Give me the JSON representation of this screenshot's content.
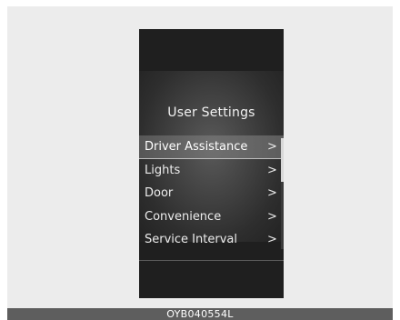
{
  "screen": {
    "title": "User Settings",
    "menu_items": [
      {
        "label": "Driver Assistance",
        "arrow": ">",
        "selected": true
      },
      {
        "label": "Lights",
        "arrow": ">",
        "selected": false
      },
      {
        "label": "Door",
        "arrow": ">",
        "selected": false
      },
      {
        "label": "Convenience",
        "arrow": ">",
        "selected": false
      },
      {
        "label": "Service Interval",
        "arrow": ">",
        "selected": false
      }
    ]
  },
  "figure_code": "OYB040554L",
  "colors": {
    "display_background": "#1f1f1f",
    "selection_highlight": "#8a8a8a",
    "text": "#ececec",
    "code_bar": "#5e5e5e"
  }
}
